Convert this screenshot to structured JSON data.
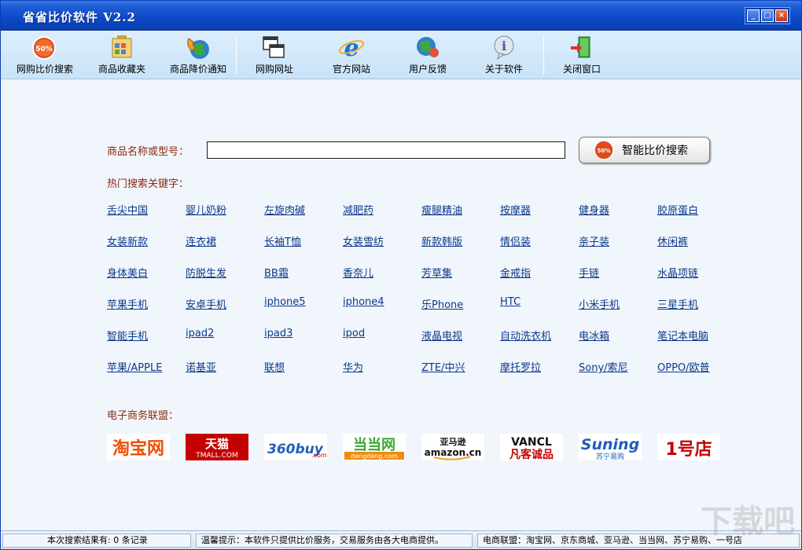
{
  "window": {
    "title": "省省比价软件 V2.2"
  },
  "toolbar": {
    "items": [
      {
        "label": "网购比价搜索",
        "icon": "price-badge-icon"
      },
      {
        "label": "商品收藏夹",
        "icon": "favorites-icon"
      },
      {
        "label": "商品降价通知",
        "icon": "phone-globe-icon"
      },
      {
        "label": "网购网址",
        "icon": "windows-icon"
      },
      {
        "label": "官方网站",
        "icon": "ie-icon"
      },
      {
        "label": "用户反馈",
        "icon": "feedback-globe-icon"
      },
      {
        "label": "关于软件",
        "icon": "info-icon"
      },
      {
        "label": "关闭窗口",
        "icon": "exit-door-icon"
      }
    ]
  },
  "search": {
    "label": "商品名称或型号：",
    "value": "",
    "button_label": "智能比价搜索",
    "badge_text": "50%"
  },
  "hot": {
    "label": "热门搜索关键字：",
    "rows": [
      [
        "舌尖中国",
        "婴儿奶粉",
        "左旋肉碱",
        "减肥药",
        "瘦腿精油",
        "按摩器",
        "健身器",
        "胶原蛋白"
      ],
      [
        "女装新款",
        "连衣裙",
        "长袖T恤",
        "女装雪纺",
        "新款韩版",
        "情侣装",
        "亲子装",
        "休闲裤"
      ],
      [
        "身体美白",
        "防脱生发",
        "BB霜",
        "香奈儿",
        "芳草集",
        "金戒指",
        "手链",
        "水晶项链"
      ],
      [
        "苹果手机",
        "安卓手机",
        "iphone5",
        "iphone4",
        "乐Phone",
        "HTC",
        "小米手机",
        "三星手机"
      ],
      [
        "智能手机",
        "ipad2",
        "ipad3",
        "ipod",
        "液晶电视",
        "自动洗衣机",
        "电冰箱",
        "笔记本电脑"
      ],
      [
        "苹果/APPLE",
        "诺基亚",
        "联想",
        "华为",
        "ZTE/中兴",
        "摩托罗拉",
        "Sony/索尼",
        "OPPO/欧普"
      ]
    ]
  },
  "ecommerce": {
    "label": "电子商务联盟：",
    "logos": [
      {
        "name": "taobao",
        "text": "淘宝网"
      },
      {
        "name": "tmall",
        "text": "天猫",
        "sub": "TMALL.COM"
      },
      {
        "name": "360buy",
        "text": "360buy",
        "sub": ".com"
      },
      {
        "name": "dangdang",
        "text": "当当网",
        "sub": "dangdang.com"
      },
      {
        "name": "amazon",
        "text": "亚马逊",
        "sub": "amazon.cn"
      },
      {
        "name": "vancl",
        "text": "VANCL",
        "sub": "凡客诚品"
      },
      {
        "name": "suning",
        "text": "Suning",
        "sub": "苏宁易购"
      },
      {
        "name": "yihaodian",
        "text": "1号店"
      }
    ]
  },
  "status": {
    "result": "本次搜索结果有: 0 条记录",
    "tip": "温馨提示：本软件只提供比价服务，交易服务由各大电商提供。",
    "union": "电商联盟：淘宝网、京东商城、亚马逊、当当网、苏宁易购、一号店"
  },
  "watermark": "下载吧"
}
